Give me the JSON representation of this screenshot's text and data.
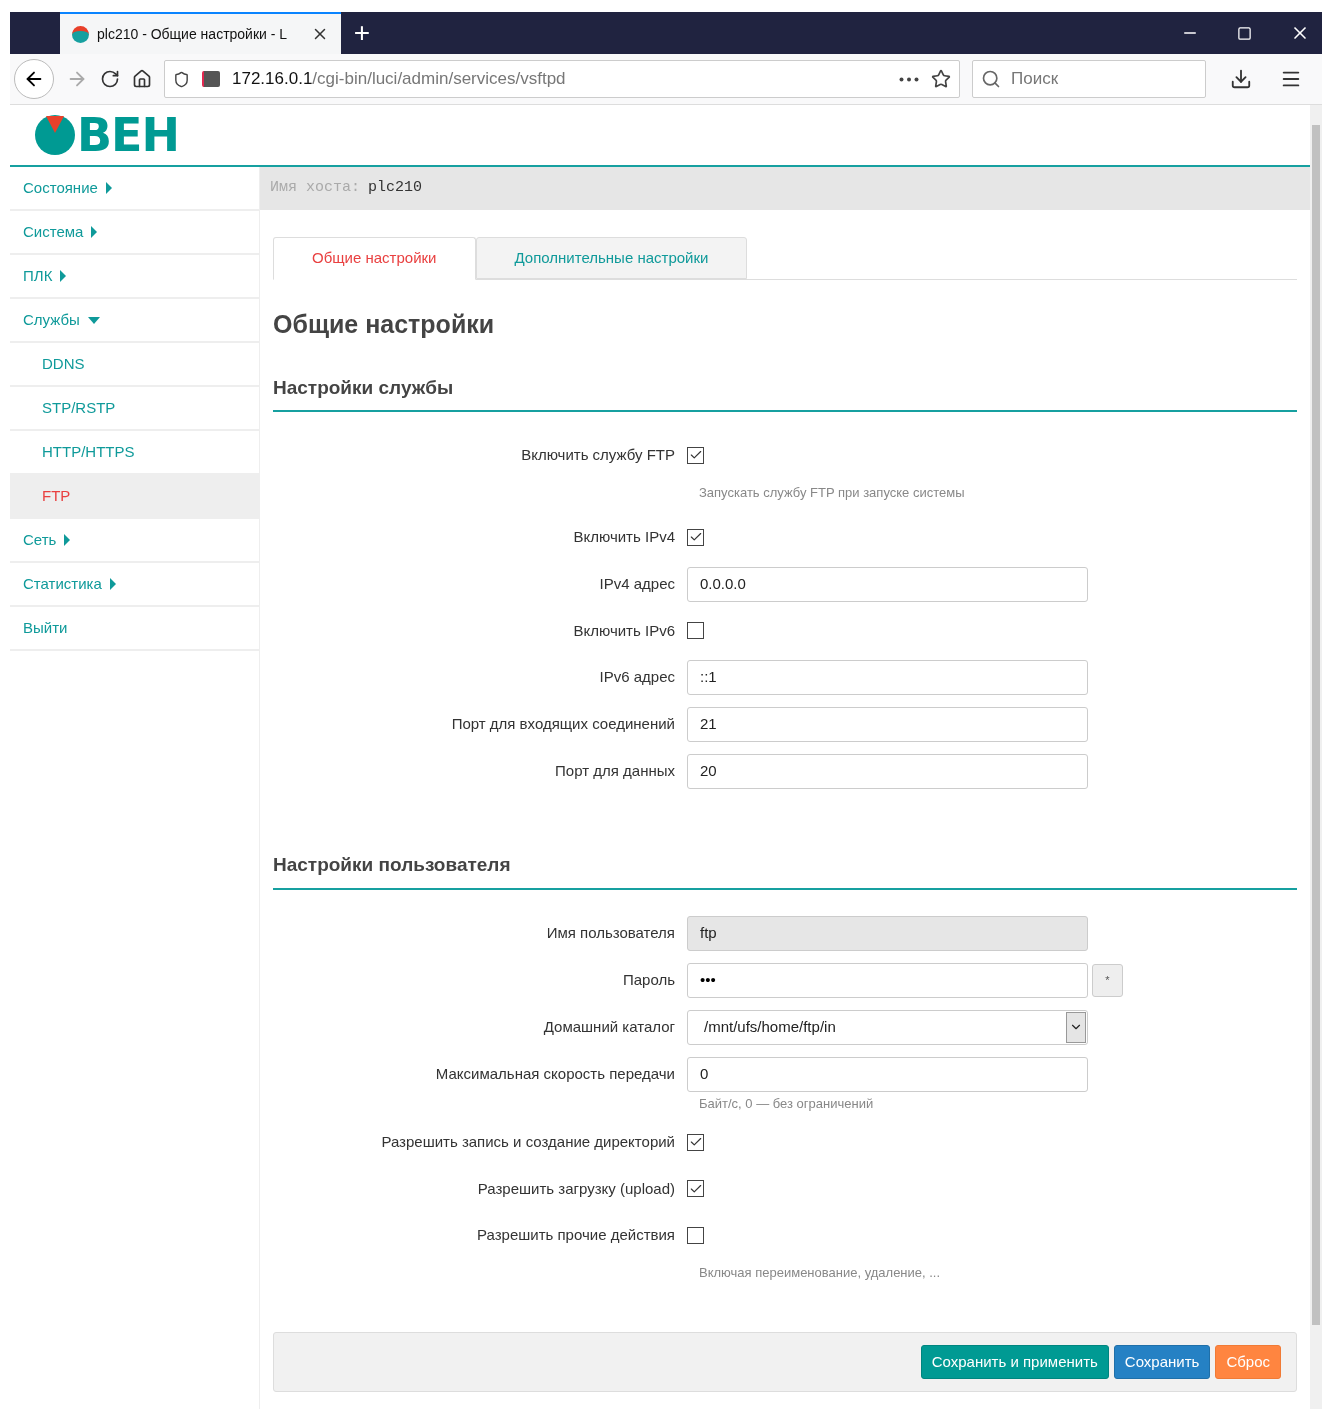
{
  "browser": {
    "tab_title": "plc210 - Общие настройки - L",
    "new_tab": "+",
    "url_host": "172.16.0.1",
    "url_path": "/cgi-bin/luci/admin/services/vsftpd",
    "search_placeholder": "Поиск"
  },
  "logo": {
    "text": "ВЕН"
  },
  "sidebar": {
    "items": [
      {
        "label": "Состояние",
        "expanded": false,
        "selected": false
      },
      {
        "label": "Система",
        "expanded": false,
        "selected": false
      },
      {
        "label": "ПЛК",
        "expanded": false,
        "selected": false
      },
      {
        "label": "Службы",
        "expanded": true,
        "selected": false,
        "children": [
          {
            "label": "DDNS",
            "selected": false
          },
          {
            "label": "STP/RSTP",
            "selected": false
          },
          {
            "label": "HTTP/HTTPS",
            "selected": false
          },
          {
            "label": "FTP",
            "selected": true
          }
        ]
      },
      {
        "label": "Сеть",
        "expanded": false,
        "selected": false
      },
      {
        "label": "Статистика",
        "expanded": false,
        "selected": false
      },
      {
        "label": "Выйти",
        "selected": false
      }
    ]
  },
  "hostbar": {
    "label": "Имя хоста:",
    "value": "plc210"
  },
  "tabs": [
    {
      "label": "Общие настройки",
      "selected": true
    },
    {
      "label": "Дополнительные настройки",
      "selected": false
    }
  ],
  "heading": "Общие настройки",
  "sections": [
    {
      "title": "Настройки службы",
      "fields": [
        {
          "kind": "checkbox",
          "label": "Включить службу FTP",
          "checked": true,
          "hint": "Запускать службу FTP при запуске системы"
        },
        {
          "kind": "checkbox",
          "label": "Включить IPv4",
          "checked": true
        },
        {
          "kind": "text",
          "label": "IPv4 адрес",
          "value": "0.0.0.0"
        },
        {
          "kind": "checkbox",
          "label": "Включить IPv6",
          "checked": false
        },
        {
          "kind": "text",
          "label": "IPv6 адрес",
          "value": "::1"
        },
        {
          "kind": "text",
          "label": "Порт для входящих соединений",
          "value": "21"
        },
        {
          "kind": "text",
          "label": "Порт для данных",
          "value": "20"
        }
      ]
    },
    {
      "title": "Настройки пользователя",
      "fields": [
        {
          "kind": "text",
          "label": "Имя пользователя",
          "value": "ftp",
          "disabled": true
        },
        {
          "kind": "password",
          "label": "Пароль",
          "value": "•••",
          "reveal": "*"
        },
        {
          "kind": "select",
          "label": "Домашний каталог",
          "value": "/mnt/ufs/home/ftp/in"
        },
        {
          "kind": "text",
          "label": "Максимальная скорость передачи",
          "value": "0",
          "hint": "Байт/с, 0 — без ограничений"
        },
        {
          "kind": "checkbox",
          "label": "Разрешить запись и создание директорий",
          "checked": true
        },
        {
          "kind": "checkbox",
          "label": "Разрешить загрузку (upload)",
          "checked": true
        },
        {
          "kind": "checkbox",
          "label": "Разрешить прочие действия",
          "checked": false,
          "hint": "Включая переименование, удаление, ..."
        }
      ]
    }
  ],
  "buttons": [
    {
      "label": "Сохранить и применить",
      "kind": "apply"
    },
    {
      "label": "Сохранить",
      "kind": "save"
    },
    {
      "label": "Сброс",
      "kind": "reset"
    }
  ]
}
